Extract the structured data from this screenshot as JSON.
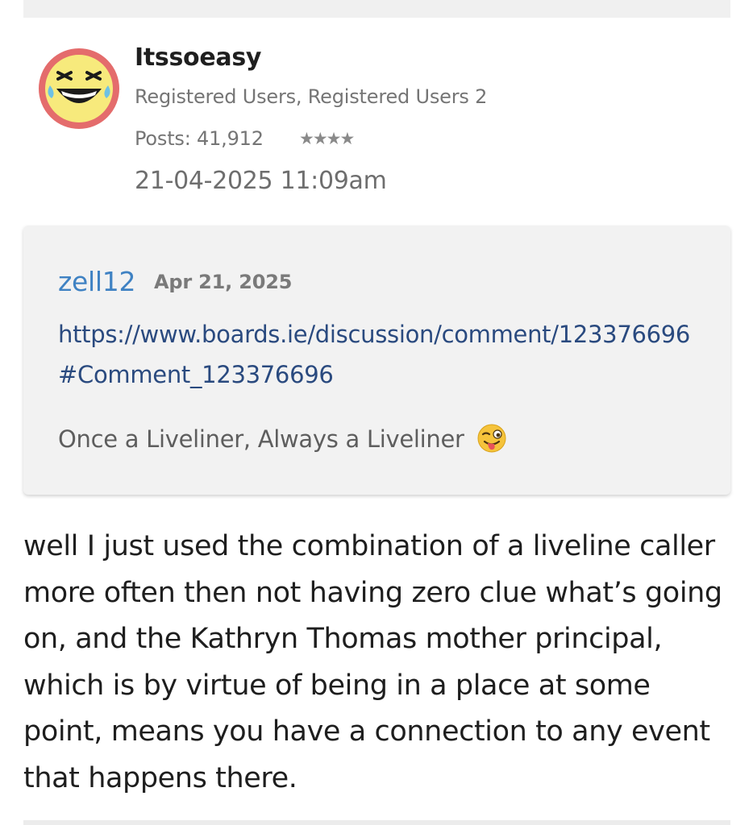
{
  "post": {
    "author": "Itssoeasy",
    "roles": "Registered Users, Registered Users 2",
    "posts_count": "Posts: 41,912",
    "rank_stars": "★★★★",
    "date": "21-04-2025 11:09am",
    "avatar_icon": "laughing-face-icon"
  },
  "quote": {
    "author": "zell12",
    "date": "Apr 21, 2025",
    "link": "https://www.boards.ie/discussion/comment/123376696#Comment_123376696",
    "text": "Once a Liveliner, Always a Liveliner",
    "emoji_icon": "winking-tongue-emoji-icon"
  },
  "body": {
    "text": "well I just used the combination of a liveline caller more often then not having zero clue what’s going on, and the Kathryn Thomas mother principal, which is by virtue of being in a place at some point, means you have a connection to any event that happens there."
  },
  "colors": {
    "quote_author": "#3f82c3",
    "link": "#2a4a7f",
    "avatar_ring": "#e46c6c",
    "avatar_face": "#f7ea7c"
  }
}
